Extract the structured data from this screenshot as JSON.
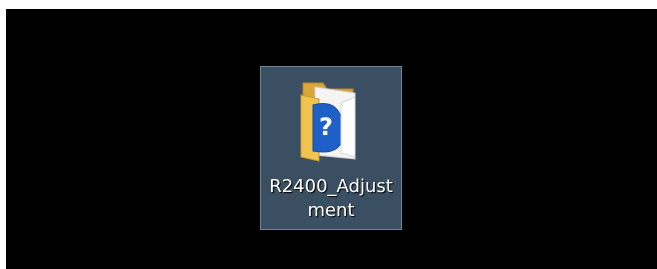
{
  "desktop": {
    "background": "#000000",
    "selection_color": "#3b4f63",
    "icon": {
      "type": "folder-with-unknown-file-icon",
      "label_line1": "R2400_Adjust",
      "label_line2": "ment",
      "selected": true
    }
  }
}
